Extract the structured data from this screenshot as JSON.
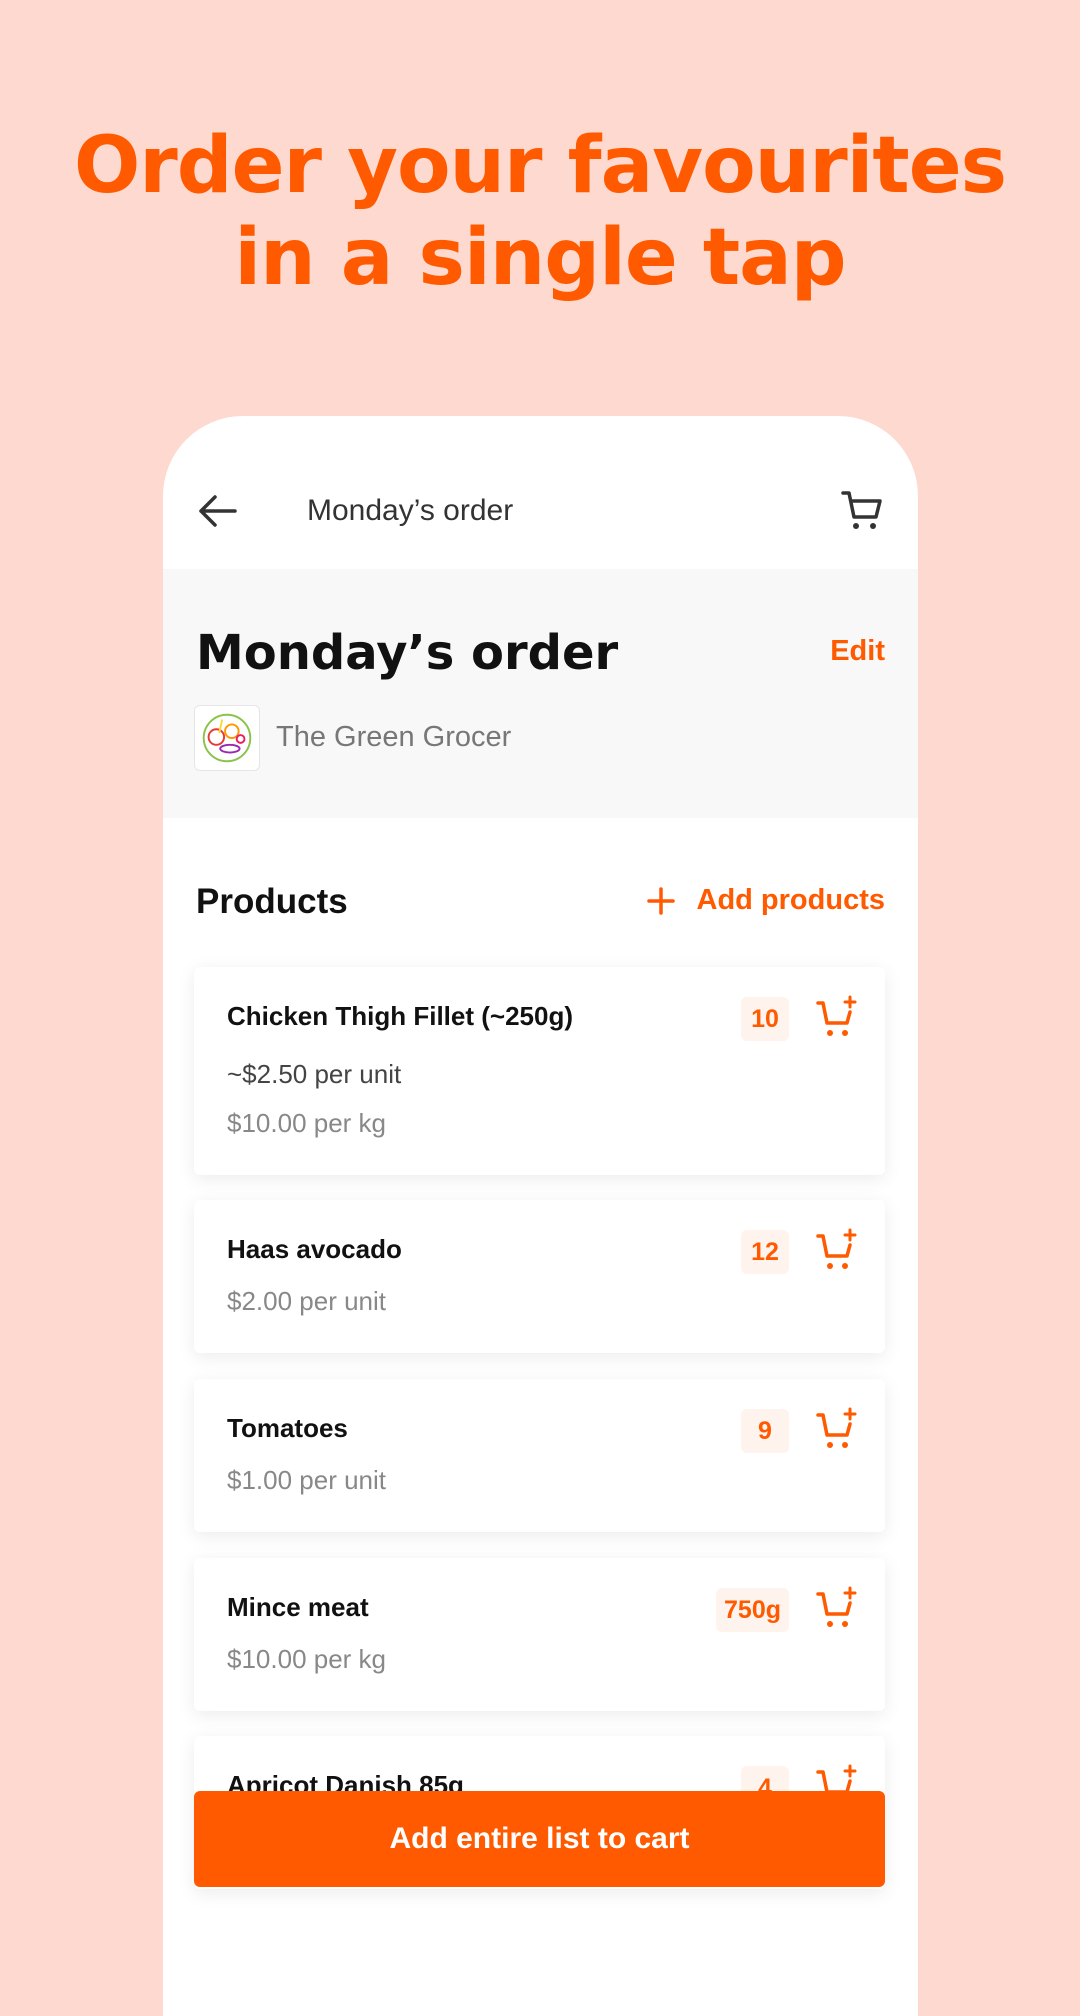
{
  "headline": [
    "Order your favourites",
    "in a single tap"
  ],
  "header": {
    "title": "Monday’s order"
  },
  "order": {
    "title": "Monday’s order",
    "edit_label": "Edit",
    "store_name": "The Green Grocer"
  },
  "products": {
    "heading": "Products",
    "add_label": "Add products",
    "items": [
      {
        "name": "Chicken Thigh Fillet (~250g)",
        "price": "~$2.50 per unit",
        "secondary_price": "$10.00 per kg",
        "qty": "10"
      },
      {
        "name": "Haas avocado",
        "price": "$2.00 per unit",
        "qty": "12"
      },
      {
        "name": "Tomatoes",
        "price": "$1.00 per unit",
        "qty": "9"
      },
      {
        "name": "Mince meat",
        "price": "$10.00 per kg",
        "qty": "750g"
      },
      {
        "name": "Apricot Danish 85g",
        "qty": "4"
      }
    ]
  },
  "cta": {
    "label": "Add entire list to cart"
  },
  "colors": {
    "accent": "#ff5a00",
    "background": "#fdd9cf"
  }
}
